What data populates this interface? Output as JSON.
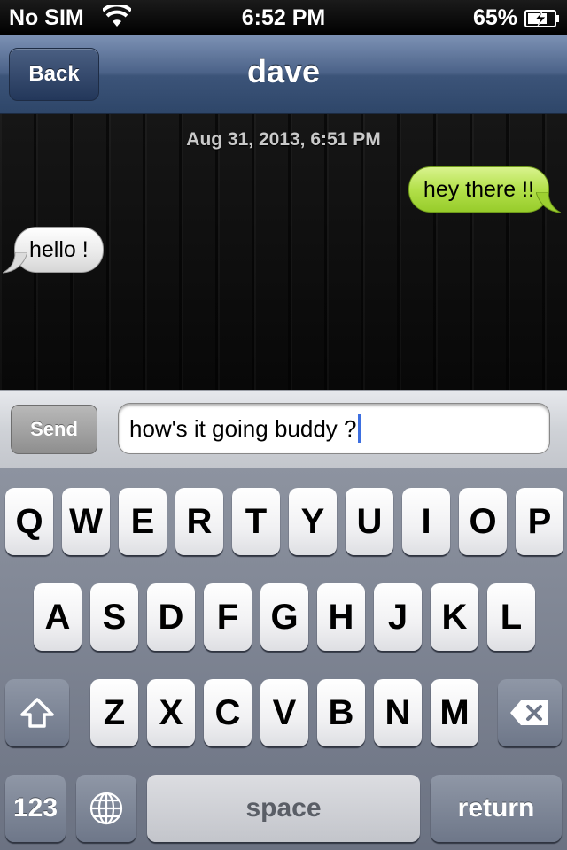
{
  "status_bar": {
    "carrier": "No SIM",
    "time": "6:52 PM",
    "battery": "65%",
    "battery_level": 0.65,
    "wifi_icon": "wifi-icon",
    "battery_icon": "battery-charging-icon"
  },
  "nav": {
    "back_label": "Back",
    "title": "dave"
  },
  "conversation": {
    "timestamp": "Aug 31, 2013, 6:51 PM",
    "messages": [
      {
        "text": "hey there !!",
        "direction": "sent",
        "color": "#b3e04a"
      },
      {
        "text": "hello !",
        "direction": "received",
        "color": "#ffffff"
      }
    ]
  },
  "compose": {
    "send_label": "Send",
    "input_value": "how's it going buddy ?"
  },
  "keyboard": {
    "row1": [
      "Q",
      "W",
      "E",
      "R",
      "T",
      "Y",
      "U",
      "I",
      "O",
      "P"
    ],
    "row2": [
      "A",
      "S",
      "D",
      "F",
      "G",
      "H",
      "J",
      "K",
      "L"
    ],
    "row3": [
      "Z",
      "X",
      "C",
      "V",
      "B",
      "N",
      "M"
    ],
    "numbers_label": "123",
    "space_label": "space",
    "return_label": "return",
    "shift_icon": "shift-icon",
    "delete_icon": "backspace-icon",
    "globe_icon": "globe-icon"
  }
}
